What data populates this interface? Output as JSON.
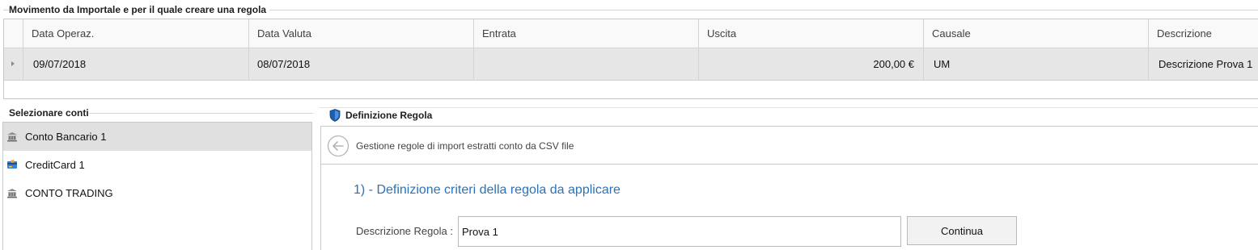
{
  "movimento": {
    "title": "Movimento da Importale e per il quale creare una regola",
    "columns": [
      "Data Operaz.",
      "Data Valuta",
      "Entrata",
      "Uscita",
      "Causale",
      "Descrizione"
    ],
    "rows": [
      {
        "data_operaz": "09/07/2018",
        "data_valuta": "08/07/2018",
        "entrata": "",
        "uscita": "200,00 €",
        "causale": "UM",
        "descrizione": "Descrizione Prova 1"
      }
    ]
  },
  "conti": {
    "title": "Selezionare conti",
    "items": [
      {
        "label": "Conto Bancario 1",
        "icon": "bank-icon",
        "selected": true
      },
      {
        "label": "CreditCard 1",
        "icon": "credit-card-icon",
        "selected": false
      },
      {
        "label": "CONTO TRADING",
        "icon": "bank-icon",
        "selected": false
      }
    ]
  },
  "regola": {
    "title": "Definizione Regola",
    "nav_text": "Gestione regole di import estratti conto da CSV file",
    "step_title": "1) - Definizione criteri della regola da applicare",
    "desc_label": "Descrizione Regola :",
    "desc_value": "Prova 1",
    "continue_label": "Continua"
  },
  "colors": {
    "accent": "#2a73b8",
    "selected_row": "#e6e6e6",
    "selected_item": "#e0e0e0"
  }
}
